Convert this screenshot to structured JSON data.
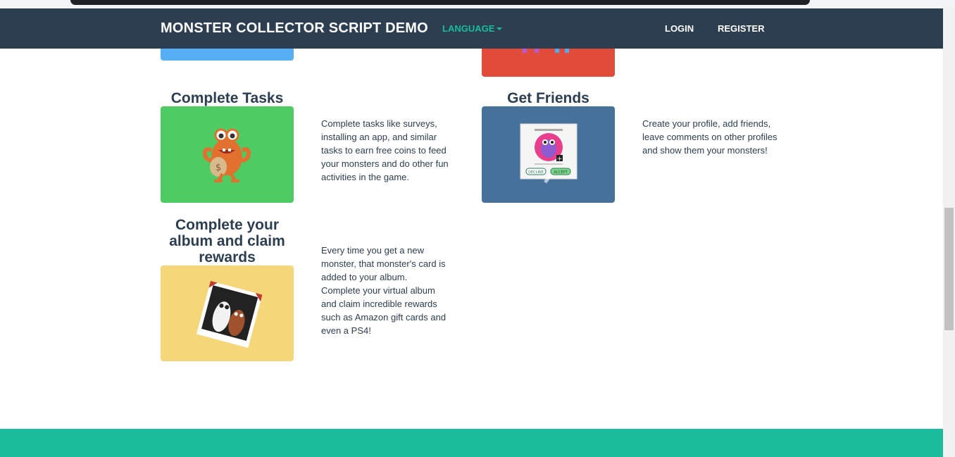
{
  "navbar": {
    "brand": "MONSTER COLLECTOR SCRIPT DEMO",
    "language": "LANGUAGE",
    "login": "LOGIN",
    "register": "REGISTER"
  },
  "features": [
    {
      "title": "Complete Tasks",
      "text": "Complete tasks like surveys, installing an app, and similar tasks to earn free coins to feed your monsters and do other fun activities in the game.",
      "image": "monster-with-money-bag",
      "color": "#4ecb63"
    },
    {
      "title": "Get Friends",
      "text": "Create your profile, add friends, leave comments on other profiles and show them your monsters!",
      "image": "friend-request-card",
      "color": "#46719b",
      "buttons": [
        "DECLINE",
        "ACCEPT"
      ]
    },
    {
      "title": "Complete your album and claim rewards",
      "text": "Every time you get a new monster, that monster's card is added to your album. Complete your virtual album and claim incredible rewards such as Amazon gift cards and even a PS4!",
      "image": "monster-photo-card",
      "color": "#f5d77a"
    }
  ],
  "colors": {
    "navbar": "#2c3e50",
    "accent": "#18bc9c",
    "footer": "#1abc9c"
  }
}
